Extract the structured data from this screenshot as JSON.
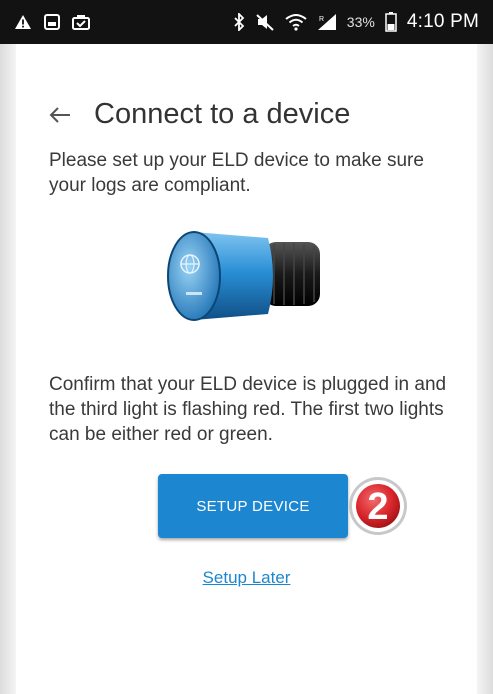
{
  "status_bar": {
    "left_icons": [
      "warning-icon",
      "gallery-icon",
      "briefcase-icon"
    ],
    "right_icons": [
      "bluetooth-icon",
      "mute-icon",
      "wifi-icon",
      "signal-icon",
      "battery-icon"
    ],
    "battery_percent": "33%",
    "time": "4:10 PM"
  },
  "header": {
    "back_icon": "arrow-left-icon",
    "title": "Connect to a device"
  },
  "main": {
    "intro_text": "Please set up your ELD device to make sure your logs are compliant.",
    "device_image": "eld-device-image",
    "confirm_text": "Confirm that your ELD device is plugged in and the third light is flashing red. The first two lights can be either red or green.",
    "setup_button_label": "SETUP DEVICE",
    "step_badge_number": "2",
    "setup_later_label": "Setup Later"
  },
  "colors": {
    "primary": "#1c87d0",
    "badge_red": "#d9262b",
    "status_bar": "#121212"
  }
}
